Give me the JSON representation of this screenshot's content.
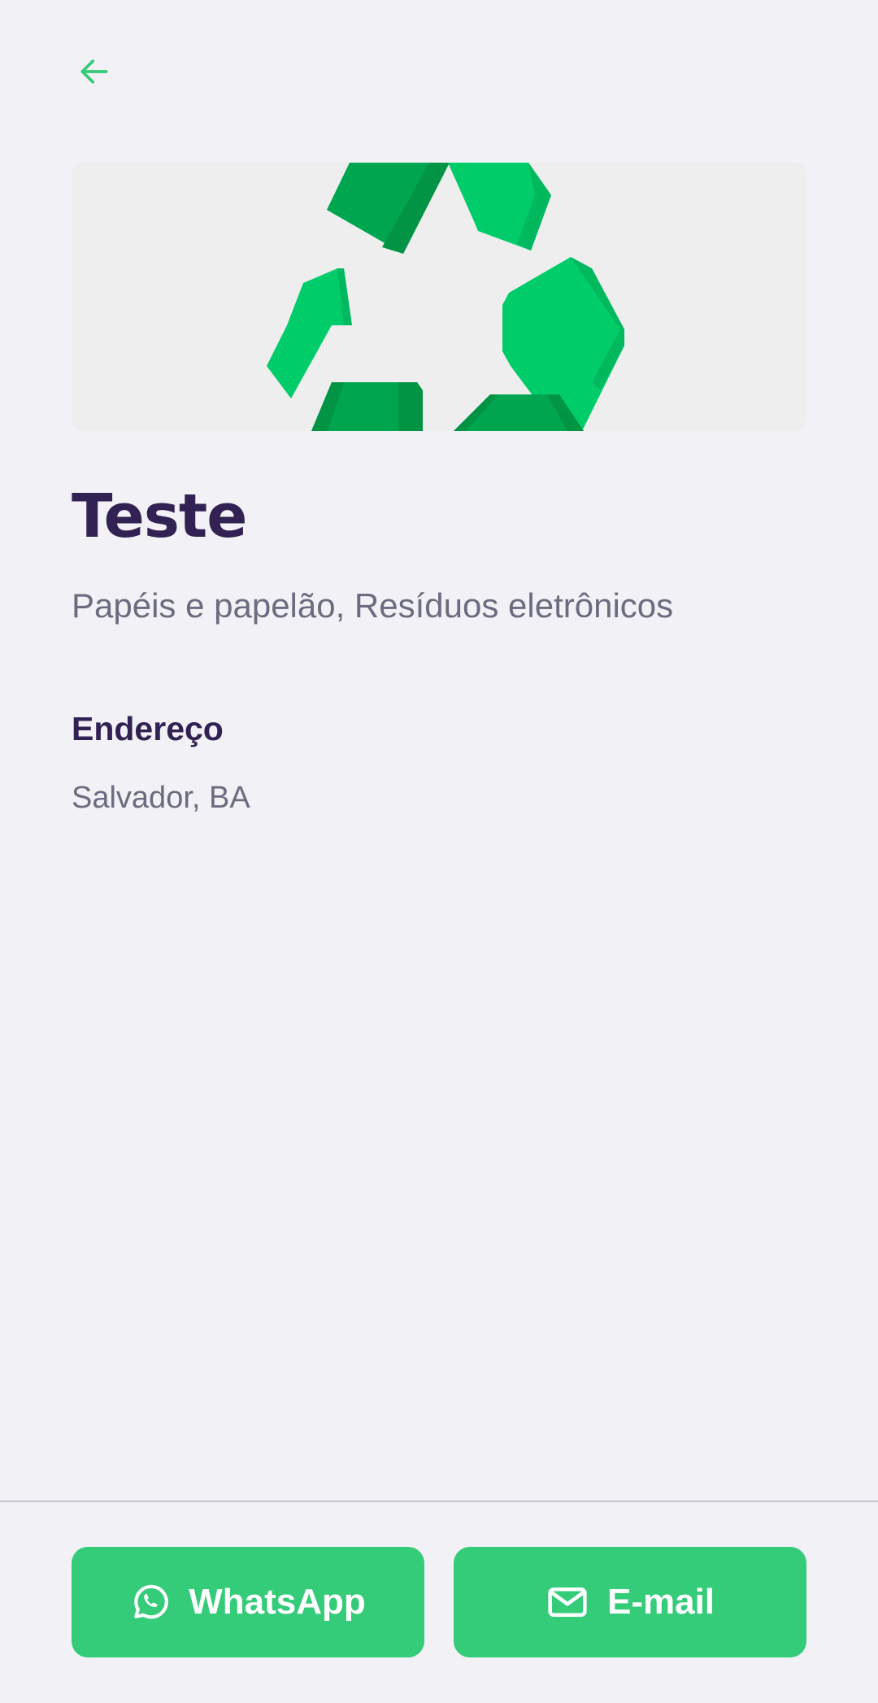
{
  "header": {
    "back_icon": "arrow-left-icon",
    "accent_color": "#34cb79"
  },
  "hero": {
    "image": "recycle-symbol"
  },
  "point": {
    "title": "Teste",
    "items": "Papéis e papelão, Resíduos eletrônicos"
  },
  "address": {
    "heading": "Endereço",
    "value": "Salvador, BA"
  },
  "footer": {
    "whatsapp_label": "WhatsApp",
    "whatsapp_icon": "whatsapp-icon",
    "email_label": "E-mail",
    "email_icon": "mail-icon",
    "button_color": "#34cb79"
  },
  "colors": {
    "title": "#322153",
    "text": "#6c6c80",
    "background": "#f1f1f6"
  }
}
